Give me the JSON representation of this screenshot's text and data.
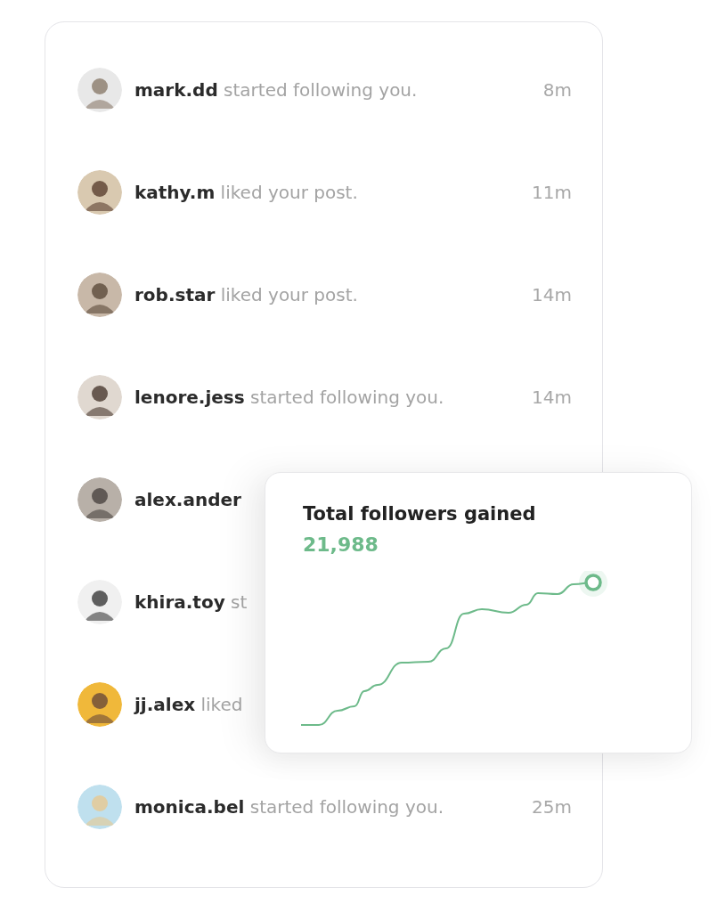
{
  "notifications": [
    {
      "user": "mark.dd",
      "action": "started following you.",
      "time": "8m"
    },
    {
      "user": "kathy.m",
      "action": "liked your post.",
      "time": "11m"
    },
    {
      "user": "rob.star",
      "action": "liked your post.",
      "time": "14m"
    },
    {
      "user": "lenore.jess",
      "action": "started following you.",
      "time": "14m"
    },
    {
      "user": "alex.ander"
    },
    {
      "user": "khira.toy",
      "action": "st"
    },
    {
      "user": "jj.alex",
      "action": "liked"
    },
    {
      "user": "monica.bel",
      "action": "started following you.",
      "time": "25m"
    }
  ],
  "followers_card": {
    "title": "Total followers gained",
    "value": "21,988"
  }
}
